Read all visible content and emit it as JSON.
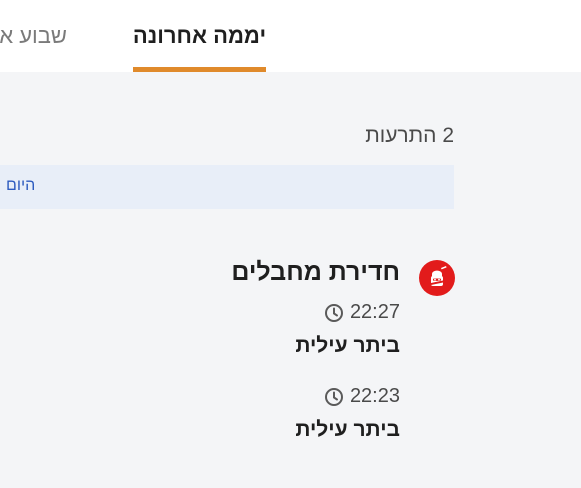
{
  "tabs": [
    {
      "label": "יממה אחרונה",
      "active": true
    },
    {
      "label": "שבוע א",
      "active": false
    }
  ],
  "summary": {
    "count_label": "2 התרעות"
  },
  "day_group": {
    "label": "היום"
  },
  "alert_group": {
    "icon": "infiltration-icon",
    "title": "חדירת מחבלים",
    "items": [
      {
        "time": "22:27",
        "location": "ביתר עילית"
      },
      {
        "time": "22:23",
        "location": "ביתר עילית"
      }
    ]
  },
  "colors": {
    "accent": "#e08a2b",
    "alert_red": "#e21b1b",
    "day_bar": "#e8eef8",
    "day_label": "#2d5bbf",
    "background": "#f4f5f7"
  }
}
